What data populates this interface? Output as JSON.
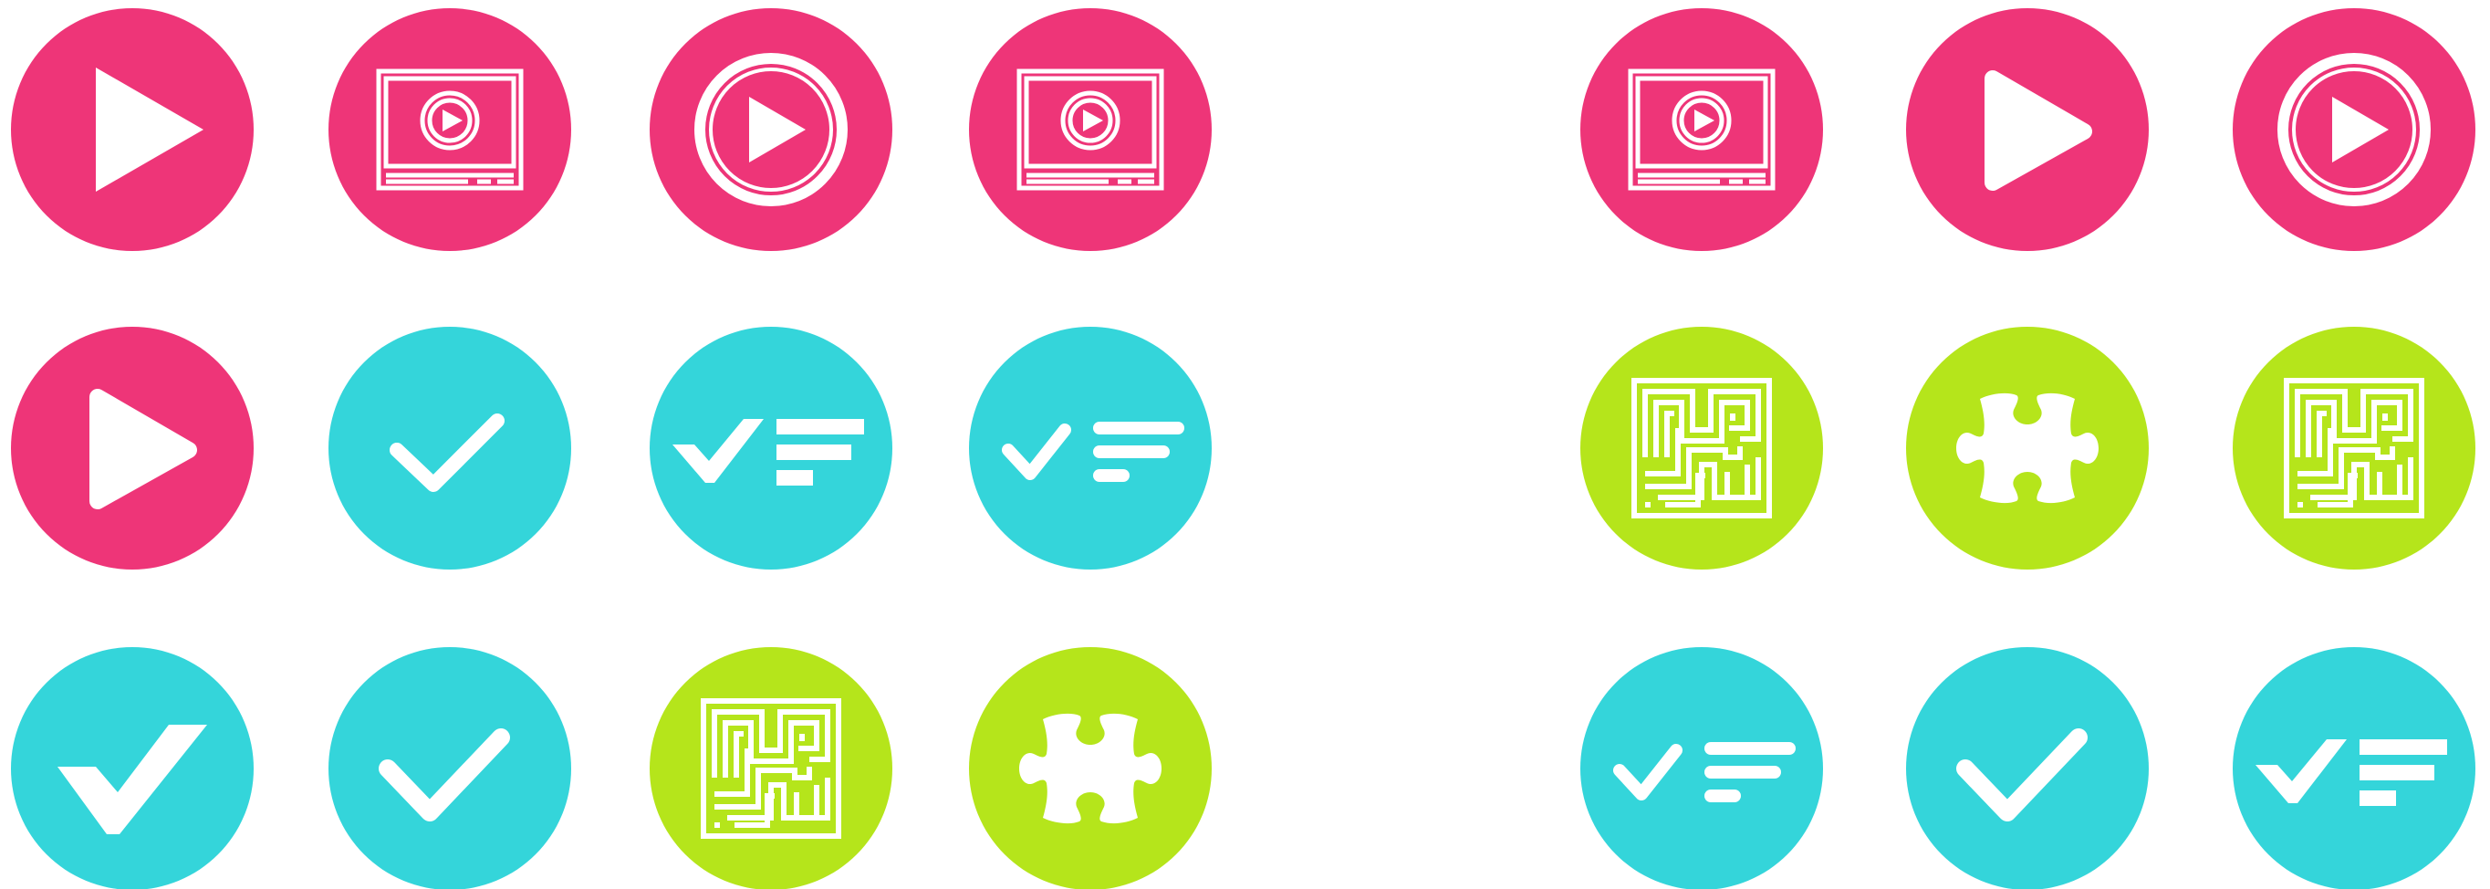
{
  "colors": {
    "pink": "#EE3578",
    "cyan": "#34D5DA",
    "lime": "#B5E51B",
    "glyph": "#FFFFFF",
    "background": "#FFFFFF"
  },
  "icons": [
    {
      "name": "play-icon",
      "icon": "play",
      "color": "pink"
    },
    {
      "name": "video-player-icon",
      "icon": "video-player",
      "color": "pink"
    },
    {
      "name": "play-circle-icon",
      "icon": "play-circle",
      "color": "pink"
    },
    {
      "name": "video-player-icon",
      "icon": "video-player",
      "color": "pink"
    },
    {
      "name": "video-player-icon",
      "icon": "video-player",
      "color": "pink"
    },
    {
      "name": "play-rounded-icon",
      "icon": "play-rounded",
      "color": "pink"
    },
    {
      "name": "play-circle-icon",
      "icon": "play-circle",
      "color": "pink"
    },
    {
      "name": "play-rounded-icon",
      "icon": "play-rounded",
      "color": "pink"
    },
    {
      "name": "checkmark-icon",
      "icon": "check-rounded",
      "color": "cyan"
    },
    {
      "name": "checklist-icon",
      "icon": "checklist-sharp",
      "color": "cyan"
    },
    {
      "name": "checklist-icon",
      "icon": "checklist-rounded",
      "color": "cyan"
    },
    {
      "name": "maze-icon",
      "icon": "maze",
      "color": "lime"
    },
    {
      "name": "puzzle-piece-icon",
      "icon": "puzzle",
      "color": "lime"
    },
    {
      "name": "maze-icon",
      "icon": "maze",
      "color": "lime"
    },
    {
      "name": "checkmark-icon",
      "icon": "check-sharp",
      "color": "cyan"
    },
    {
      "name": "checkmark-icon",
      "icon": "check-thick",
      "color": "cyan"
    },
    {
      "name": "maze-icon",
      "icon": "maze",
      "color": "lime"
    },
    {
      "name": "puzzle-piece-icon",
      "icon": "puzzle",
      "color": "lime"
    },
    {
      "name": "checklist-icon",
      "icon": "checklist-rounded",
      "color": "cyan"
    },
    {
      "name": "checkmark-icon",
      "icon": "check-thick",
      "color": "cyan"
    },
    {
      "name": "checklist-icon",
      "icon": "checklist-sharp",
      "color": "cyan"
    }
  ]
}
